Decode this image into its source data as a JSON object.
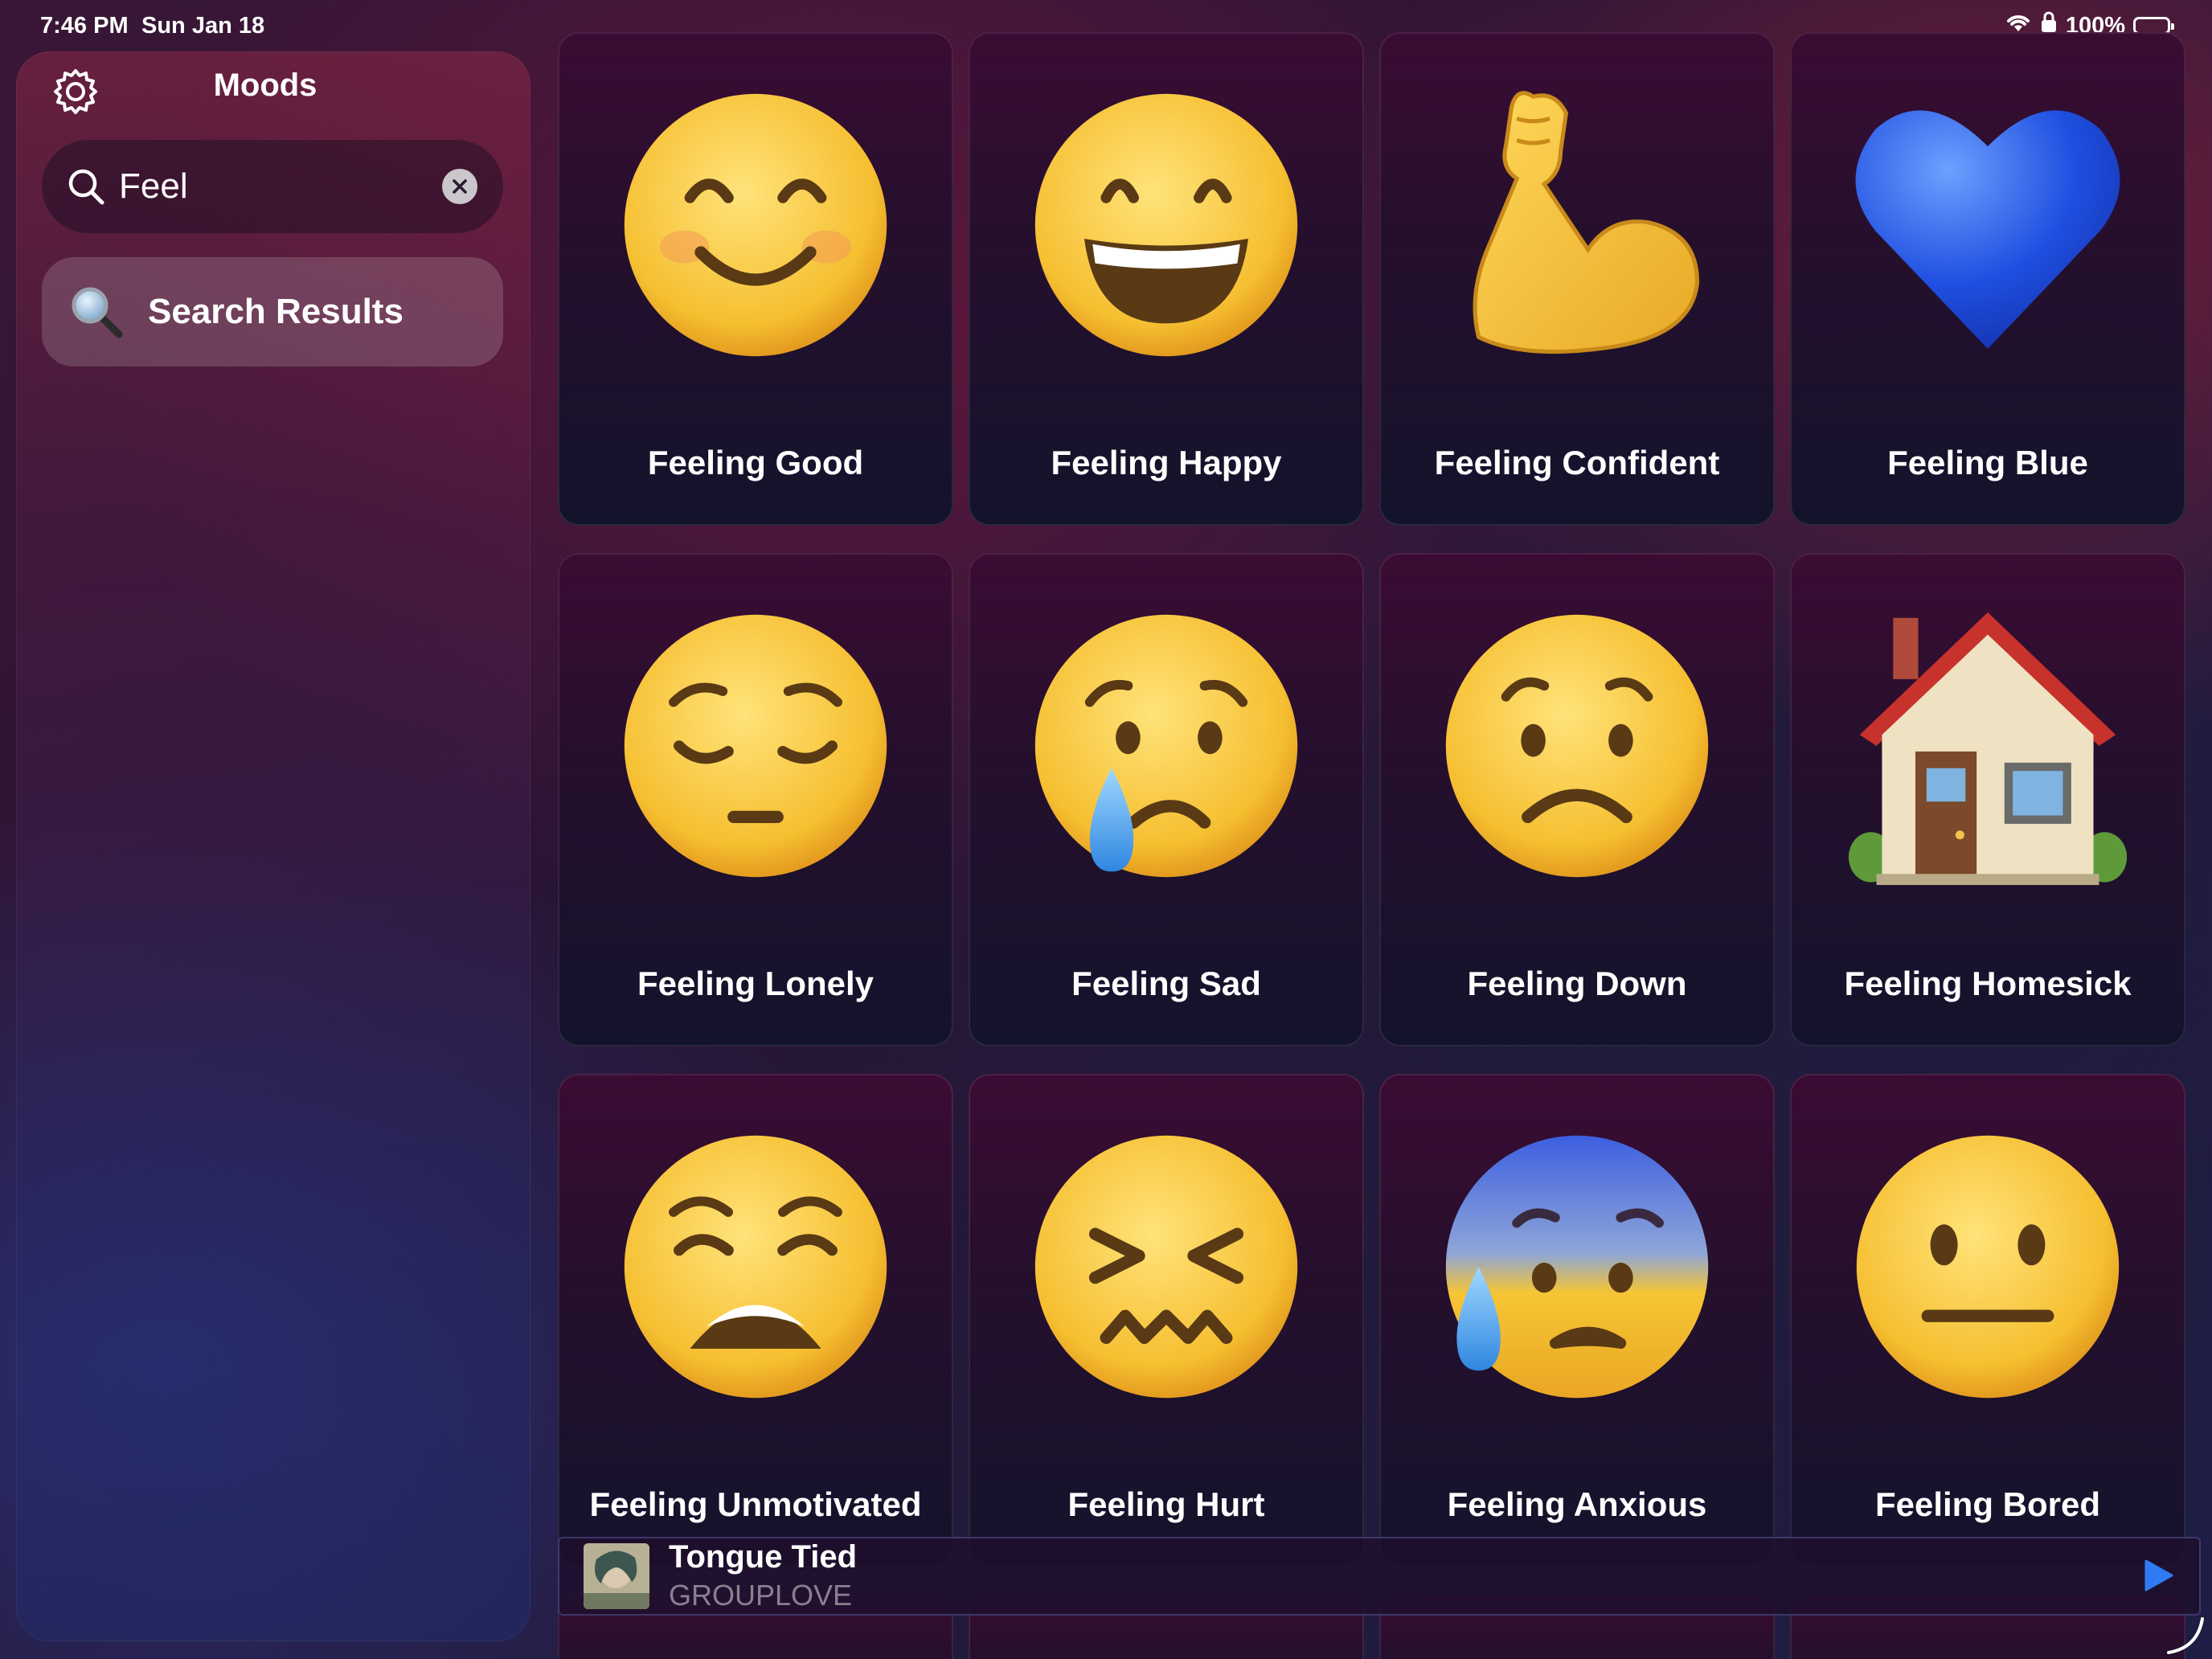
{
  "status_bar": {
    "time": "7:46 PM",
    "date": "Sun Jan 18",
    "battery": "100%"
  },
  "sidebar": {
    "title": "Moods",
    "search": {
      "value": "Feel",
      "placeholder": "Search"
    },
    "items": [
      {
        "label": "Search Results"
      }
    ]
  },
  "moods": [
    {
      "label": "Feeling Good",
      "icon": "smiling-face-icon"
    },
    {
      "label": "Feeling Happy",
      "icon": "grinning-face-icon"
    },
    {
      "label": "Feeling Confident",
      "icon": "flexed-biceps-icon"
    },
    {
      "label": "Feeling Blue",
      "icon": "blue-heart-icon"
    },
    {
      "label": "Feeling Lonely",
      "icon": "pensive-face-icon"
    },
    {
      "label": "Feeling Sad",
      "icon": "crying-face-icon"
    },
    {
      "label": "Feeling Down",
      "icon": "frowning-face-icon"
    },
    {
      "label": "Feeling Homesick",
      "icon": "house-icon"
    },
    {
      "label": "Feeling Unmotivated",
      "icon": "weary-face-icon"
    },
    {
      "label": "Feeling Hurt",
      "icon": "confounded-face-icon"
    },
    {
      "label": "Feeling Anxious",
      "icon": "anxious-face-with-sweat-icon"
    },
    {
      "label": "Feeling Bored",
      "icon": "neutral-face-icon"
    }
  ],
  "now_playing": {
    "title": "Tongue Tied",
    "artist": "GROUPLOVE"
  },
  "colors": {
    "accent": "#2f7bf5",
    "emoji_yellow": "#f7c53a",
    "heart_blue": "#1f4fe0"
  }
}
